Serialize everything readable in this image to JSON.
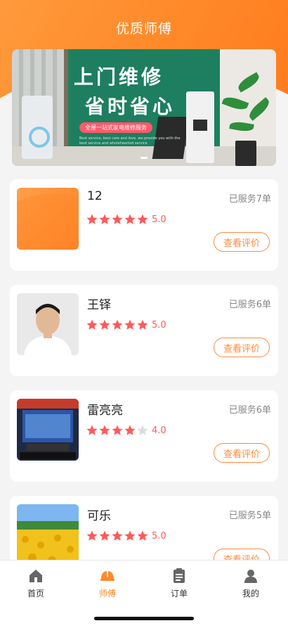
{
  "header": {
    "title": "优质师傅"
  },
  "banner": {
    "line1": "上门维修",
    "line2": "省时省心",
    "tagline": "全屋一站式家电维修服务",
    "small_text": "Best service, best care and love, we provide you with the best service and wholehearted service"
  },
  "workers": [
    {
      "name": "12",
      "served": "已服务7单",
      "rating": 5,
      "score": "5.0",
      "button": "查看评价"
    },
    {
      "name": "王铎",
      "served": "已服务6单",
      "rating": 5,
      "score": "5.0",
      "button": "查看评价"
    },
    {
      "name": "雷亮亮",
      "served": "已服务6单",
      "rating": 4,
      "score": "4.0",
      "button": "查看评价"
    },
    {
      "name": "可乐",
      "served": "已服务5单",
      "rating": 5,
      "score": "5.0",
      "button": "查看评价"
    }
  ],
  "tabs": [
    {
      "label": "首页",
      "icon": "home-icon"
    },
    {
      "label": "师傅",
      "icon": "worker-helmet-icon",
      "active": true
    },
    {
      "label": "订单",
      "icon": "order-list-icon"
    },
    {
      "label": "我的",
      "icon": "user-icon"
    }
  ],
  "colors": {
    "accent": "#ff8a2a",
    "star": "#ff5a5a",
    "star_empty": "#dddddd"
  }
}
